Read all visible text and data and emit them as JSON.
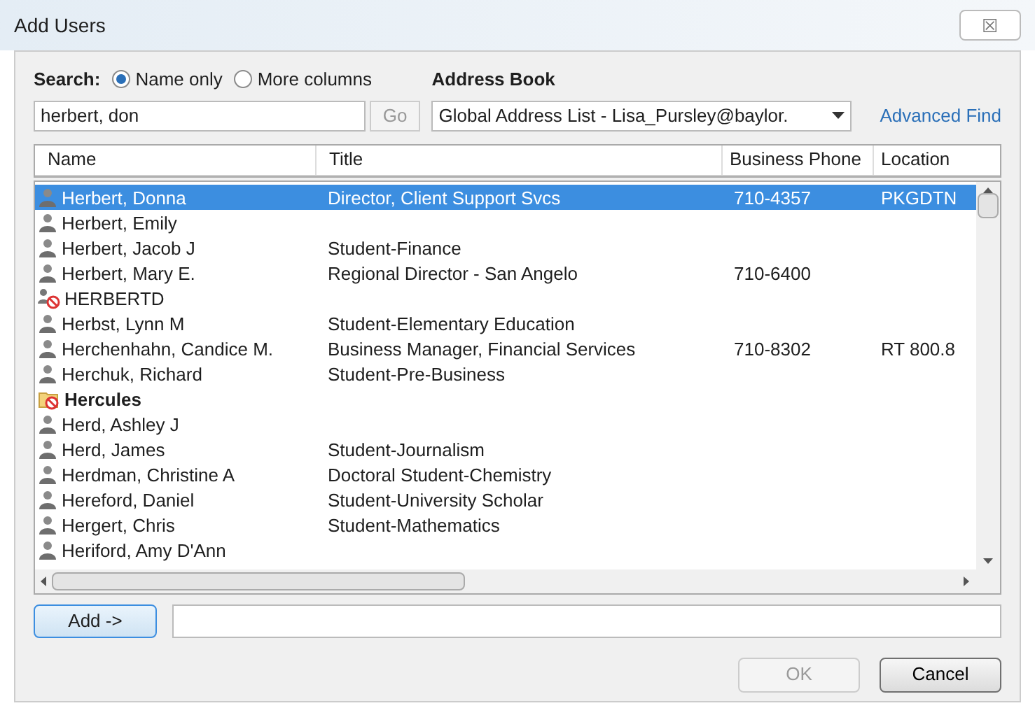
{
  "window": {
    "title": "Add Users",
    "close_glyph": "☒"
  },
  "search": {
    "label": "Search:",
    "options": [
      {
        "label": "Name only",
        "selected": true
      },
      {
        "label": "More columns",
        "selected": false
      }
    ],
    "value": "herbert, don",
    "go": {
      "label": "Go",
      "disabled": true
    }
  },
  "address_book": {
    "label": "Address Book",
    "value": "Global Address List - Lisa_Pursley@baylor.",
    "advanced_find": "Advanced Find"
  },
  "table": {
    "columns": [
      "Name",
      "Title",
      "Business Phone",
      "Location"
    ],
    "rows": [
      {
        "kind": "person",
        "selected": true,
        "name": "Herbert, Donna",
        "title": "Director, Client Support Svcs",
        "phone": "710-4357",
        "location": "PKGDTN"
      },
      {
        "kind": "person",
        "selected": false,
        "name": "Herbert, Emily"
      },
      {
        "kind": "person",
        "selected": false,
        "name": "Herbert, Jacob J",
        "title": "Student-Finance"
      },
      {
        "kind": "person",
        "selected": false,
        "name": "Herbert, Mary E.",
        "title": "Regional Director - San Angelo",
        "phone": "710-6400"
      },
      {
        "kind": "blocked",
        "selected": false,
        "name": "HERBERTD"
      },
      {
        "kind": "person",
        "selected": false,
        "name": "Herbst, Lynn M",
        "title": "Student-Elementary Education"
      },
      {
        "kind": "person",
        "selected": false,
        "name": "Herchenhahn, Candice M.",
        "title": "Business Manager, Financial Services",
        "phone": "710-8302",
        "location": "RT 800.8"
      },
      {
        "kind": "person",
        "selected": false,
        "name": "Herchuk, Richard",
        "title": "Student-Pre-Business"
      },
      {
        "kind": "group",
        "selected": false,
        "name": "Hercules"
      },
      {
        "kind": "person",
        "selected": false,
        "name": "Herd, Ashley J"
      },
      {
        "kind": "person",
        "selected": false,
        "name": "Herd, James",
        "title": "Student-Journalism"
      },
      {
        "kind": "person",
        "selected": false,
        "name": "Herdman, Christine A",
        "title": "Doctoral Student-Chemistry"
      },
      {
        "kind": "person",
        "selected": false,
        "name": "Hereford, Daniel",
        "title": "Student-University Scholar"
      },
      {
        "kind": "person",
        "selected": false,
        "name": "Hergert, Chris",
        "title": "Student-Mathematics"
      },
      {
        "kind": "person",
        "selected": false,
        "name": "Heriford, Amy D'Ann"
      }
    ]
  },
  "add": {
    "label": "Add ->"
  },
  "buttons": [
    {
      "label": "OK",
      "disabled": true
    },
    {
      "label": "Cancel",
      "disabled": false
    }
  ]
}
